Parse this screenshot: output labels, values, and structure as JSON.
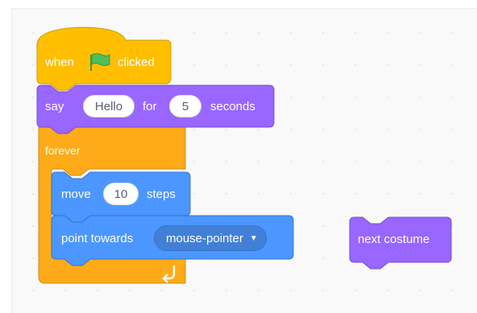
{
  "blocks": {
    "hat": {
      "when": "when",
      "clicked": "clicked",
      "flag": "green-flag-icon"
    },
    "say": {
      "label": "say",
      "message": "Hello",
      "for": "for",
      "secs": "5",
      "seconds": "seconds"
    },
    "forever": {
      "label": "forever",
      "loop_arrow": "loop-arrow-icon"
    },
    "move": {
      "label": "move",
      "steps_value": "10",
      "steps": "steps"
    },
    "point": {
      "label": "point towards",
      "target": "mouse-pointer"
    },
    "next_costume": {
      "label": "next costume"
    }
  },
  "colors": {
    "events": "#ffbf00",
    "control": "#ffab19",
    "looks": "#9966ff",
    "motion": "#4c97ff",
    "flag_green": "#4cbf56"
  }
}
